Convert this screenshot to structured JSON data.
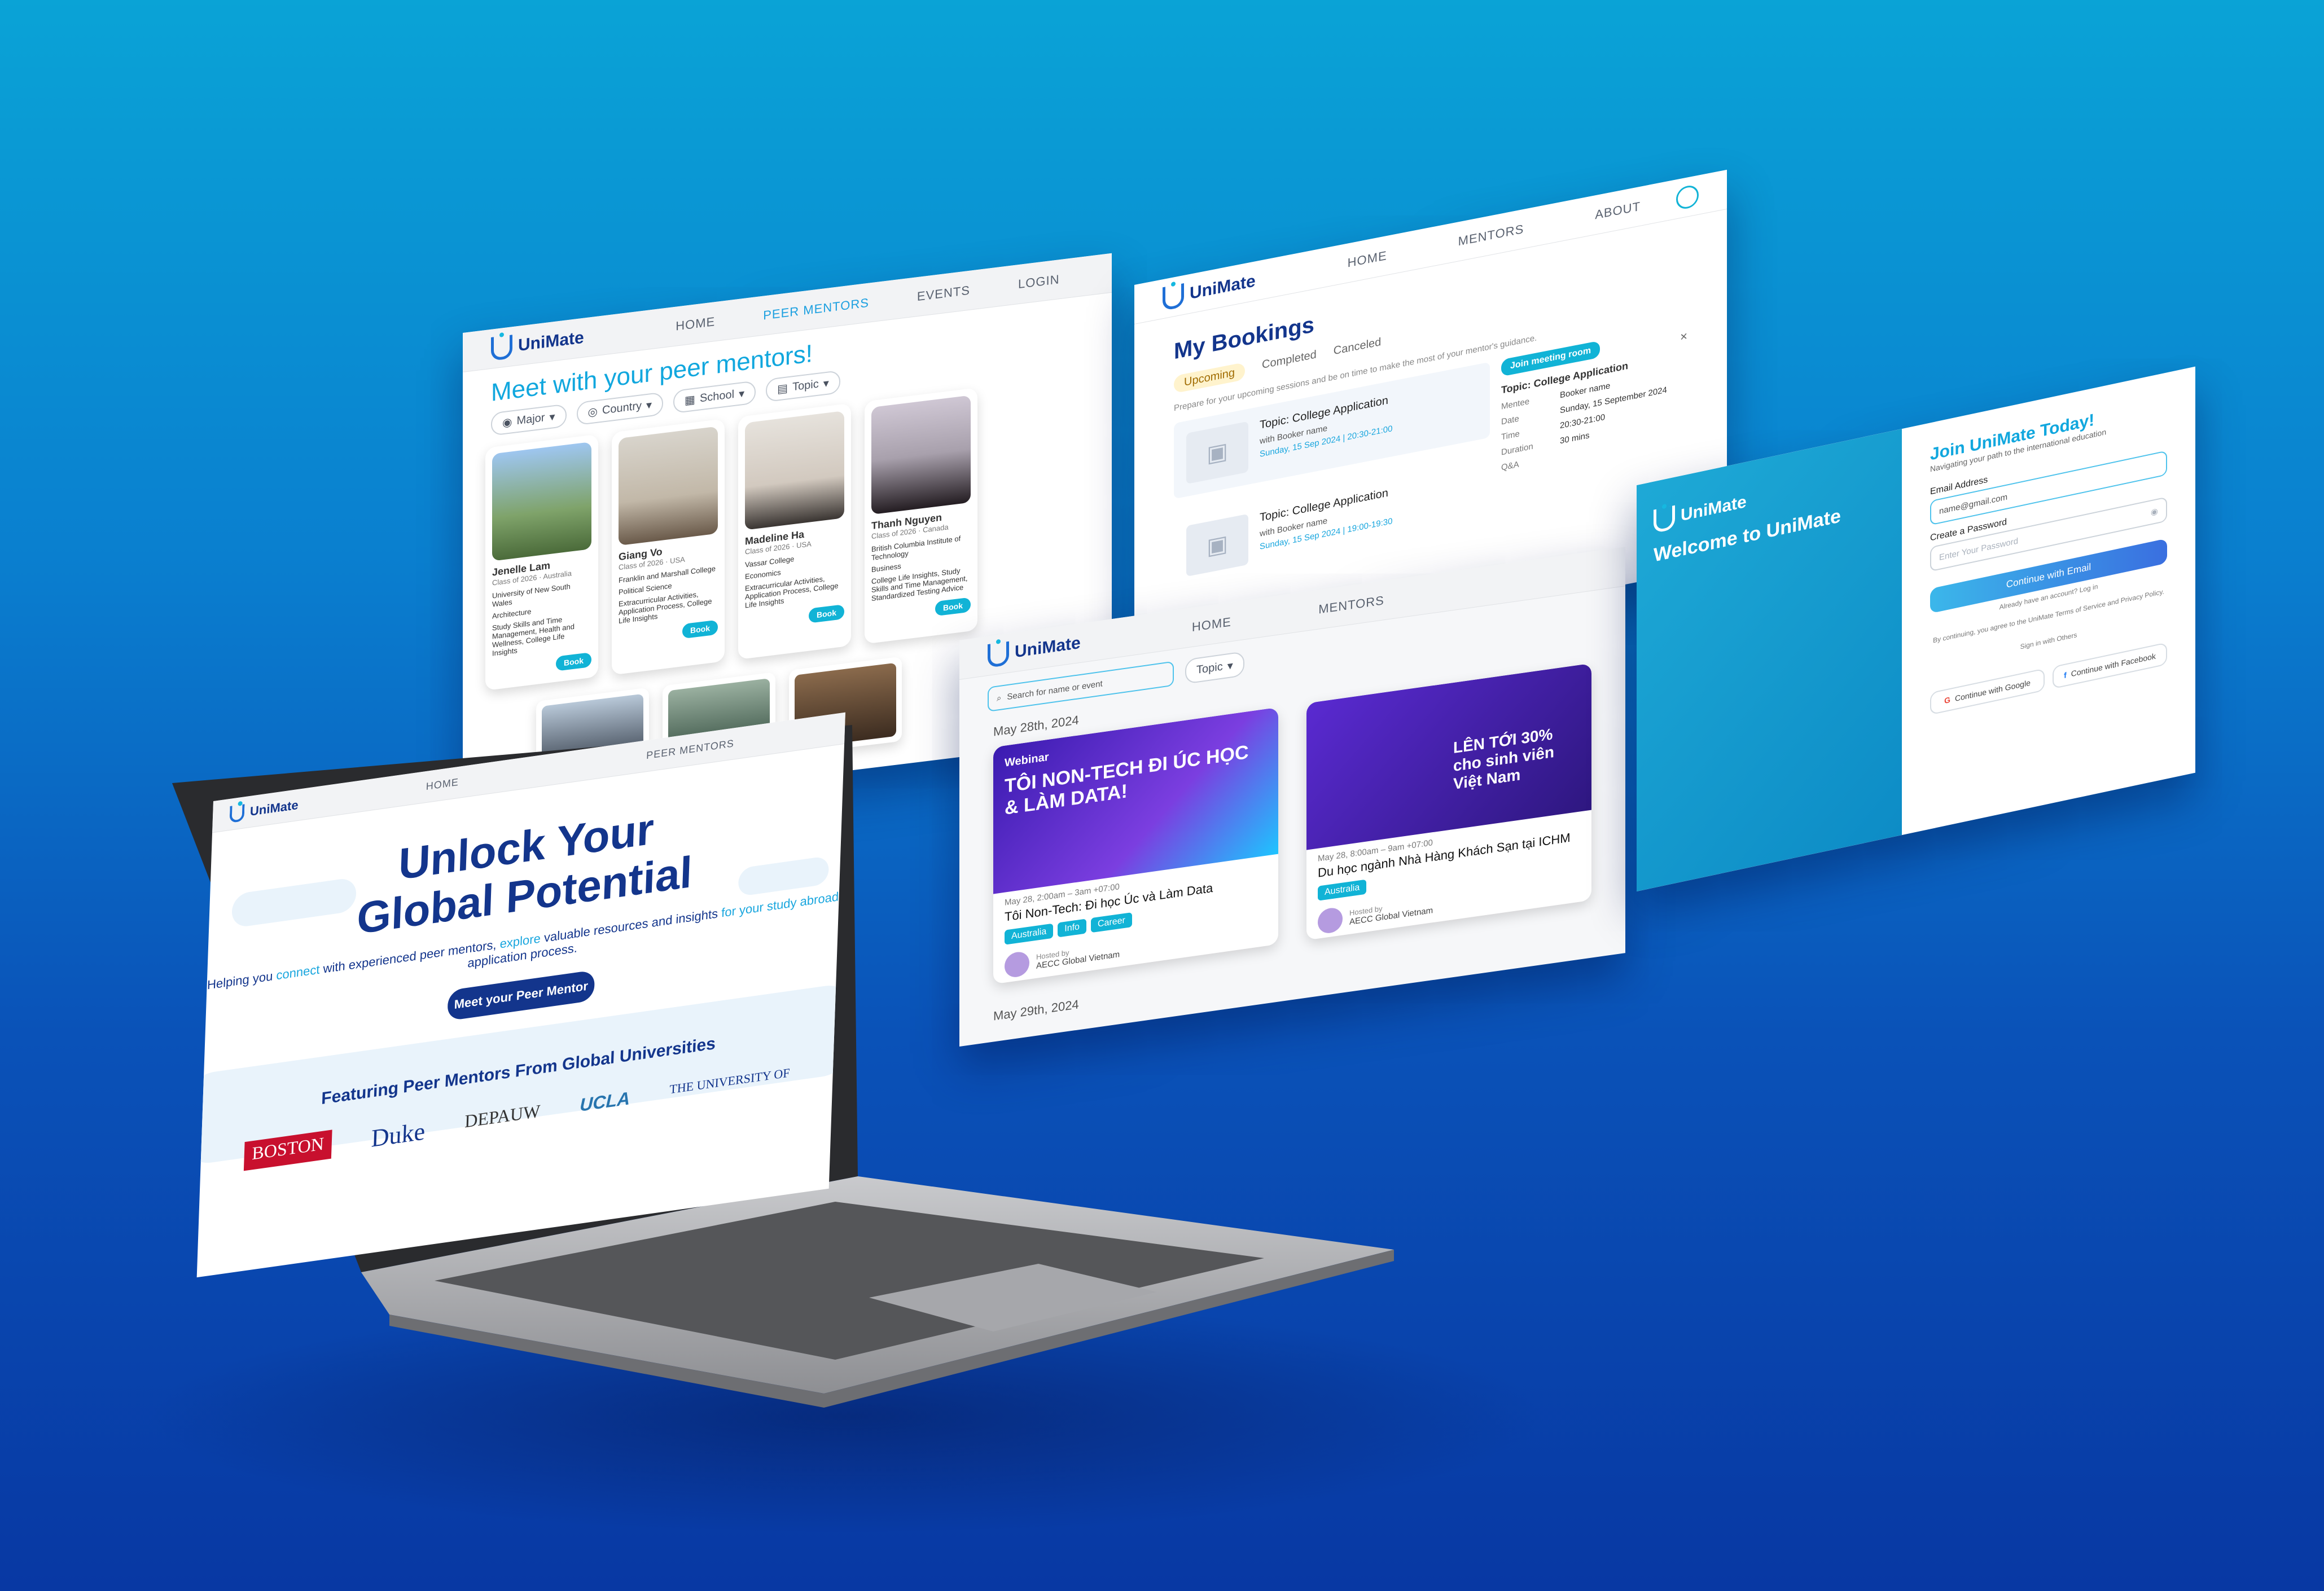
{
  "brand": {
    "name": "UniMate",
    "primary": "#13358c",
    "accent": "#11b3d6"
  },
  "mentors_page": {
    "nav": {
      "home": "HOME",
      "peer_mentors": "PEER MENTORS",
      "events": "EVENTS",
      "login": "LOGIN"
    },
    "title": "Meet with your peer mentors!",
    "filters": [
      "Major",
      "Country",
      "School",
      "Topic"
    ],
    "book_label": "Book",
    "mentors": [
      {
        "name": "Jenelle Lam",
        "class": "Class of 2026",
        "country": "Australia",
        "school": "University of New South Wales",
        "major": "Architecture",
        "topics": "Study Skills and Time Management, Health and Wellness, College Life Insights"
      },
      {
        "name": "Giang Vo",
        "class": "Class of 2026",
        "country": "USA",
        "school": "Franklin and Marshall College",
        "major": "Political Science",
        "topics": "Extracurricular Activities, Application Process, College Life Insights"
      },
      {
        "name": "Madeline Ha",
        "class": "Class of 2026",
        "country": "USA",
        "school": "Vassar College",
        "major": "Economics",
        "topics": "Extracurricular Activities, Application Process, College Life Insights"
      },
      {
        "name": "Thanh Nguyen",
        "class": "Class of 2026",
        "country": "Canada",
        "school": "British Columbia Institute of Technology",
        "major": "Business",
        "topics": "College Life Insights, Study Skills and Time Management, Standardized Testing Advice"
      }
    ]
  },
  "bookings_page": {
    "nav": {
      "home": "HOME",
      "mentors": "MENTORS",
      "about": "ABOUT"
    },
    "title": "My Bookings",
    "tabs": [
      "Upcoming",
      "Completed",
      "Canceled"
    ],
    "note": "Prepare for your upcoming sessions and be on time to make the most of your mentor's guidance.",
    "items": [
      {
        "topic": "Topic: College Application",
        "with": "with Booker name",
        "when": "Sunday, 15 Sep 2024 | 20:30-21:00"
      },
      {
        "topic": "Topic: College Application",
        "with": "with Booker name",
        "when": "Sunday, 15 Sep 2024 | 19:00-19:30"
      }
    ],
    "detail": {
      "join": "Join meeting room",
      "topic": "Topic: College Application",
      "rows": [
        {
          "k": "Mentee",
          "v": "Booker name"
        },
        {
          "k": "Date",
          "v": "Sunday, 15 September 2024"
        },
        {
          "k": "Time",
          "v": "20:30-21:00"
        },
        {
          "k": "Duration",
          "v": "30 mins"
        },
        {
          "k": "Q&A",
          "v": ""
        }
      ],
      "close": "×"
    }
  },
  "login_page": {
    "logo": "UniMate",
    "welcome": "Welcome to UniMate",
    "join": "Join UniMate Today!",
    "join_sub": "Navigating your path to the international education",
    "email_label": "Email Address",
    "email_value": "name@gmail.com",
    "password_label": "Create a Password",
    "password_placeholder": "Enter Your Password",
    "continue": "Continue with Email",
    "have_account": "Already have an account? Log in",
    "terms": "By continuing, you agree to the UniMate Terms of Service and Privacy Policy.",
    "or": "Sign in with Others",
    "google": "Continue with Google",
    "facebook": "Continue with Facebook"
  },
  "events_page": {
    "nav": {
      "home": "HOME",
      "mentors": "MENTORS"
    },
    "search_placeholder": "Search for name or event",
    "topic_filter": "Topic",
    "date1": "May 28th, 2024",
    "date2": "May 29th, 2024",
    "events": [
      {
        "badge": "Webinar",
        "banner": "TÔI NON-TECH ĐI ÚC HỌC & LÀM DATA!",
        "meta": "May 28, 2:00am – 3am +07:00",
        "title": "Tôi Non-Tech: Đi học Úc và Làm Data",
        "tags": [
          "Australia",
          "Info",
          "Career"
        ],
        "host_label": "Hosted by",
        "host": "AECC Global Vietnam"
      },
      {
        "badge": "",
        "banner": "LÊN TỚI 30% cho sinh viên Việt Nam",
        "meta": "May 28, 8:00am – 9am +07:00",
        "title": "Du học ngành Nhà Hàng Khách Sạn tại ICHM",
        "tags": [
          "Australia"
        ],
        "host_label": "Hosted by",
        "host": "AECC Global Vietnam"
      }
    ]
  },
  "home_page": {
    "nav": {
      "home": "HOME",
      "peer_mentors": "PEER MENTORS"
    },
    "hero_line1": "Unlock Your",
    "hero_line2": "Global Potential",
    "sub_a": "Helping you ",
    "sub_b": "connect",
    "sub_c": " with experienced peer mentors, ",
    "sub_d": "explore",
    "sub_e": " valuable resources and insights ",
    "sub_f": "for your study abroad",
    "sub_g": " application process.",
    "cta": "Meet your Peer Mentor",
    "featuring": "Featuring Peer Mentors From Global Universities",
    "universities": [
      "BOSTON",
      "Duke",
      "DEPAUW",
      "UCLA",
      "THE UNIVERSITY OF"
    ]
  }
}
